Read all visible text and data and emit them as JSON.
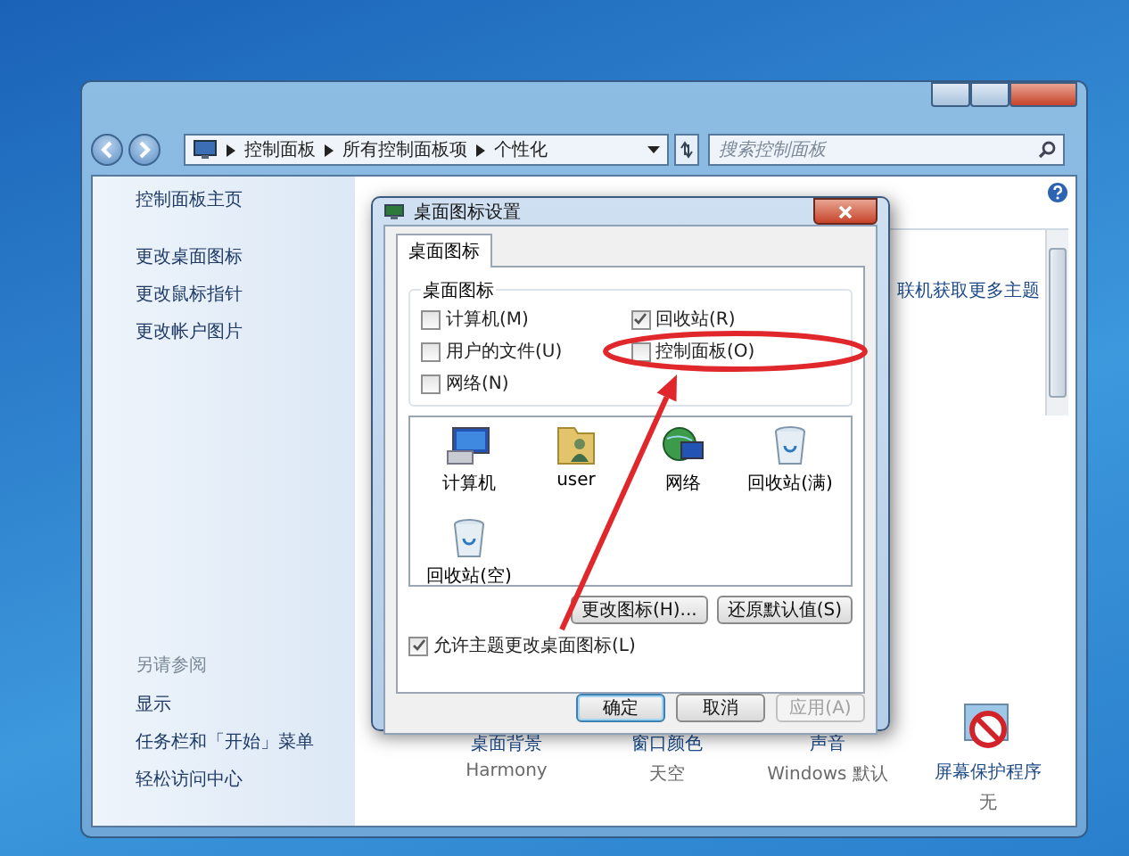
{
  "window": {
    "breadcrumb": [
      "控制面板",
      "所有控制面板项",
      "个性化"
    ],
    "search": {
      "placeholder": "搜索控制面板"
    }
  },
  "sidebar": {
    "items": [
      "控制面板主页",
      "更改桌面图标",
      "更改鼠标指针",
      "更改帐户图片"
    ],
    "see_also": {
      "heading": "另请参阅",
      "items": [
        "显示",
        "任务栏和「开始」菜单",
        "轻松访问中心"
      ]
    }
  },
  "main": {
    "theme_link": "联机获取更多主题",
    "settings": [
      {
        "label": "桌面背景",
        "value": "Harmony",
        "kind": "background"
      },
      {
        "label": "窗口颜色",
        "value": "天空",
        "kind": "color"
      },
      {
        "label": "声音",
        "value": "Windows 默认",
        "kind": "sound"
      },
      {
        "label": "屏幕保护程序",
        "value": "无",
        "kind": "screensaver"
      }
    ]
  },
  "dialog": {
    "title": "桌面图标设置",
    "tabs": [
      {
        "label": "桌面图标",
        "selected": true
      }
    ],
    "group": {
      "title": "桌面图标",
      "checkboxes": [
        {
          "label": "计算机(M)",
          "checked": false
        },
        {
          "label": "用户的文件(U)",
          "checked": false
        },
        {
          "label": "网络(N)",
          "checked": false
        },
        {
          "label": "回收站(R)",
          "checked": true
        },
        {
          "label": "控制面板(O)",
          "checked": false
        }
      ]
    },
    "icons": [
      {
        "label": "计算机",
        "kind": "computer"
      },
      {
        "label": "user",
        "kind": "user"
      },
      {
        "label": "网络",
        "kind": "network"
      },
      {
        "label": "回收站(满)",
        "kind": "bin"
      },
      {
        "label": "回收站(空)",
        "kind": "bin"
      }
    ],
    "buttons": [
      "更改图标(H)...",
      "还原默认值(S)"
    ],
    "allow_themes": {
      "label": "允许主题更改桌面图标(L)",
      "checked": true
    },
    "footer_buttons": [
      {
        "label": "确定",
        "disabled": false
      },
      {
        "label": "取消",
        "disabled": false
      },
      {
        "label": "应用(A)",
        "disabled": true
      }
    ]
  }
}
